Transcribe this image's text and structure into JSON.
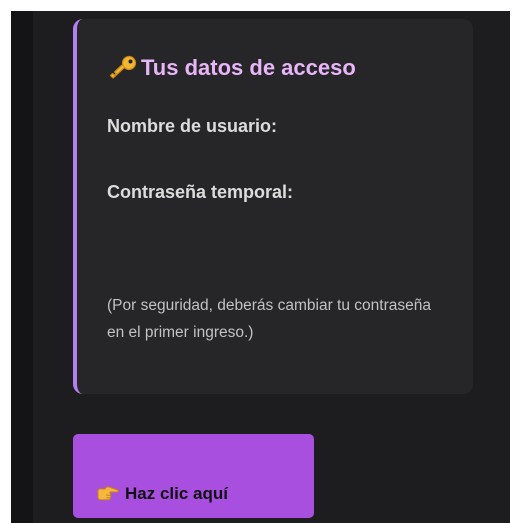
{
  "card": {
    "title": "Tus datos de acceso",
    "title_icon": "key-icon",
    "username_label": "Nombre de usuario:",
    "username_value": "",
    "password_label": "Contraseña temporal:",
    "password_value": "",
    "note": "(Por seguridad, deberás cambiar tu contraseña en el primer ingreso.)"
  },
  "cta": {
    "label": "Haz clic aquí",
    "icon": "pointing-hand-icon"
  },
  "colors": {
    "accent": "#b67ff0",
    "title": "#e8b5f8",
    "button": "#a84fe0",
    "card_background": "#262629",
    "body_background": "#1d1d20"
  }
}
